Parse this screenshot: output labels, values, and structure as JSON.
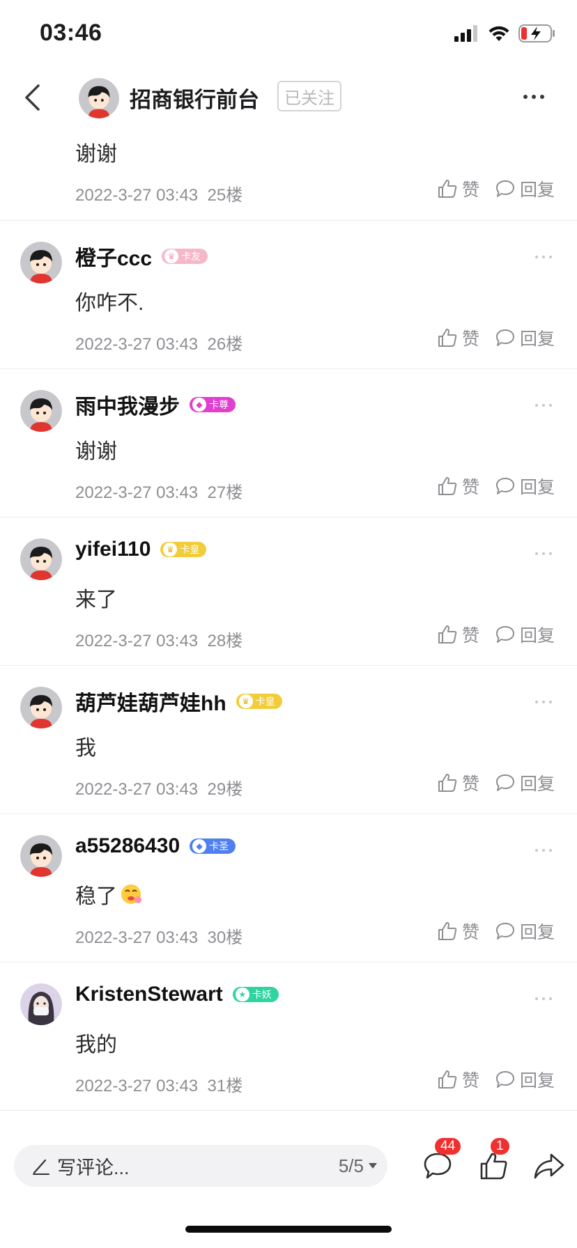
{
  "status": {
    "time": "03:46"
  },
  "nav": {
    "title": "招商银行前台",
    "follow_label": "已关注"
  },
  "actions": {
    "like_label": "赞",
    "reply_label": "回复"
  },
  "comments": [
    {
      "name": "",
      "badge": "",
      "text": "谢谢",
      "date": "2022-3-27 03:43",
      "floor": "25楼"
    },
    {
      "name": "橙子ccc",
      "badge": "卡友",
      "badge_color": "#f5b8c9",
      "text": "你咋不.",
      "date": "2022-3-27 03:43",
      "floor": "26楼"
    },
    {
      "name": "雨中我漫步",
      "badge": "卡尊",
      "badge_color": "#e03fd0",
      "text": "谢谢",
      "date": "2022-3-27 03:43",
      "floor": "27楼"
    },
    {
      "name": "yifei110",
      "badge": "卡皇",
      "badge_color": "#f2cc3a",
      "text": "来了",
      "date": "2022-3-27 03:43",
      "floor": "28楼"
    },
    {
      "name": "葫芦娃葫芦娃hh",
      "badge": "卡皇",
      "badge_color": "#f2cc3a",
      "text": "我",
      "date": "2022-3-27 03:43",
      "floor": "29楼"
    },
    {
      "name": "a55286430",
      "badge": "卡圣",
      "badge_color": "#4f7ff0",
      "text": "稳了",
      "date": "2022-3-27 03:43",
      "floor": "30楼"
    },
    {
      "name": "KristenStewart",
      "badge": "卡妖",
      "badge_color": "#2fd4a0",
      "text": "我的",
      "date": "2022-3-27 03:43",
      "floor": "31楼"
    }
  ],
  "bottom": {
    "placeholder": "写评论...",
    "page": "5/5",
    "comment_count": "44",
    "like_count": "1"
  },
  "colors": {
    "badge_red": "#f0302e",
    "meta_gray": "#8e8e93"
  }
}
